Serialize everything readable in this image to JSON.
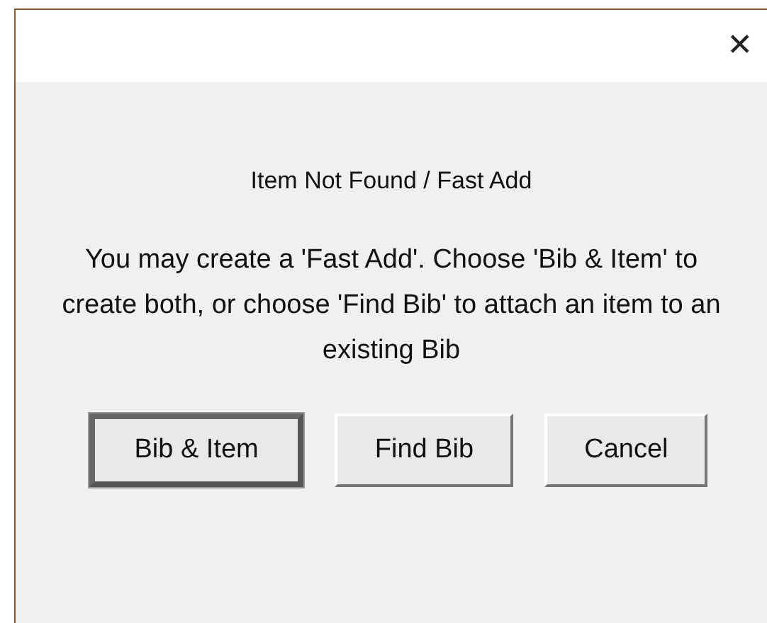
{
  "window": {
    "close_glyph": "✕"
  },
  "heading": "Item Not Found / Fast Add",
  "message": "You may create a 'Fast Add'. Choose 'Bib & Item' to create both, or choose 'Find Bib' to attach an item to an existing Bib",
  "buttons": [
    {
      "label": "Bib & Item",
      "default": true
    },
    {
      "label": "Find Bib",
      "default": false
    },
    {
      "label": "Cancel",
      "default": false
    }
  ]
}
